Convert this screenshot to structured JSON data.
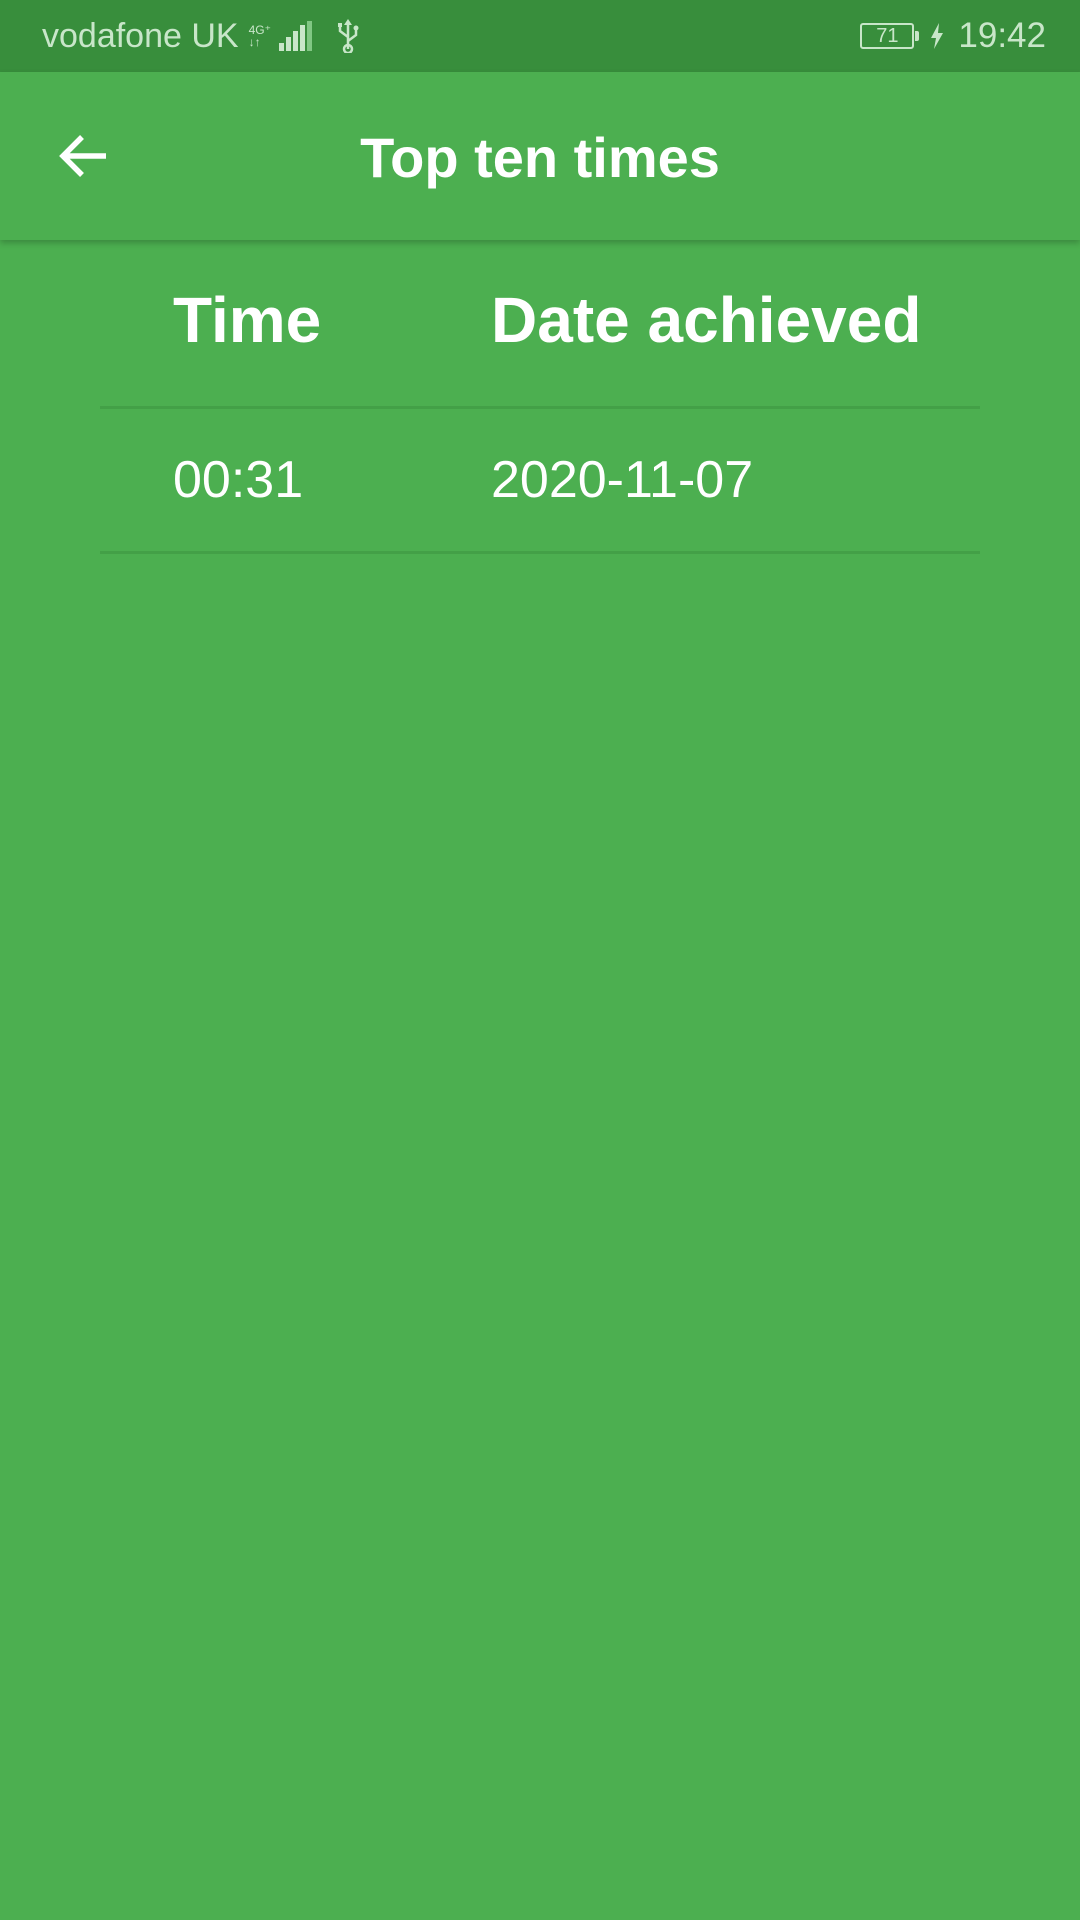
{
  "status_bar": {
    "carrier": "vodafone UK",
    "network_top": "4G⁺",
    "network_bottom": "↓↑",
    "battery_level": "71",
    "time": "19:42",
    "text_color": "#c8e6c9",
    "background": "#388e3c"
  },
  "app_bar": {
    "title": "Top ten times",
    "back_icon": "arrow-back-icon",
    "background": "#4caf50"
  },
  "table": {
    "headers": [
      "Time",
      "Date achieved"
    ],
    "rows": [
      [
        "00:31",
        "2020-11-07"
      ]
    ],
    "divider_color": "#43a047"
  },
  "theme": {
    "page_background": "#4caf50",
    "text_color": "#ffffff"
  }
}
